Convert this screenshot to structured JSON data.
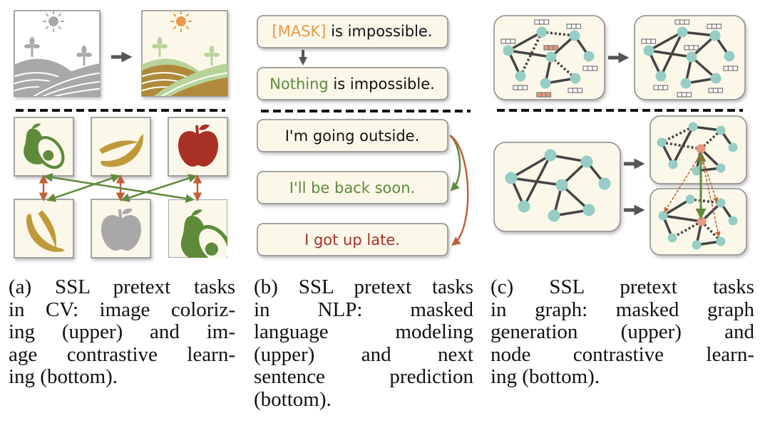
{
  "colors": {
    "cream": "#fbf8ea",
    "box_border": "#8a8a8a",
    "gray_fill": "#a8a8a8",
    "green": "#5e8a3a",
    "light_green": "#b7d39a",
    "olive_brown": "#b08a3a",
    "banana": "#c09a3a",
    "apple_red": "#a83024",
    "orange": "#e89a48",
    "rust_arrow": "#c0603a",
    "node_teal": "#96cdc4",
    "node_salmon": "#e59a80",
    "edge": "#444444",
    "arrow_gray": "#555555"
  },
  "panel_b": {
    "masked_sentence": {
      "mask_token": "[MASK]",
      "rest": " is impossible."
    },
    "filled_sentence": {
      "filled_word": "Nothing",
      "rest": " is impossible."
    },
    "anchor_sentence": "I'm going outside.",
    "positive_sentence": "I'll be back soon.",
    "negative_sentence": "I got up late."
  },
  "panel_a": {
    "top": [
      "grayscale-landscape",
      "colorized-landscape"
    ],
    "row1": [
      "avocado",
      "banana",
      "apple"
    ],
    "row2": [
      "banana",
      "apple-gray",
      "avocado-cropped"
    ]
  },
  "captions": {
    "a": [
      "(a) SSL pretext tasks",
      "in CV: image coloriz-",
      "ing (upper) and im-",
      "age contrastive learn-",
      "ing (bottom)."
    ],
    "b": [
      "(b) SSL pretext tasks",
      "in NLP: masked",
      "language modeling",
      "(upper) and next",
      "sentence prediction",
      "(bottom)."
    ],
    "c": [
      "(c) SSL pretext tasks",
      "in graph: masked graph",
      "generation (upper) and",
      "node contrastive learn-",
      "ing (bottom)."
    ]
  }
}
